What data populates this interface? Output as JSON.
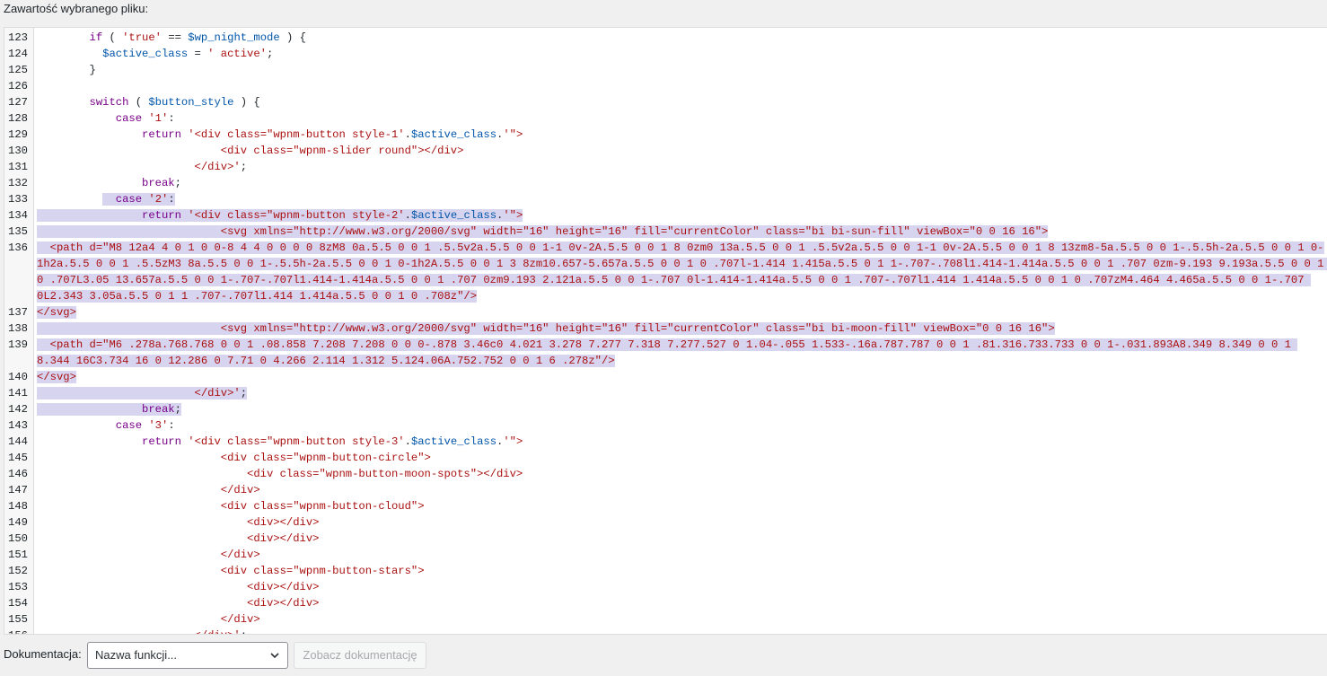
{
  "header": {
    "title": "Zawartość wybranego pliku:"
  },
  "editor": {
    "lines": [
      {
        "n": "123",
        "sel": false,
        "segs": [
          [
            "plain",
            "        "
          ],
          [
            "kw",
            "if"
          ],
          [
            "plain",
            " ( "
          ],
          [
            "str",
            "'true'"
          ],
          [
            "plain",
            " == "
          ],
          [
            "var",
            "$wp_night_mode"
          ],
          [
            "plain",
            " ) {"
          ]
        ]
      },
      {
        "n": "124",
        "sel": false,
        "segs": [
          [
            "plain",
            "          "
          ],
          [
            "var",
            "$active_class"
          ],
          [
            "plain",
            " = "
          ],
          [
            "str",
            "' active'"
          ],
          [
            "plain",
            ";"
          ]
        ]
      },
      {
        "n": "125",
        "sel": false,
        "segs": [
          [
            "plain",
            "        }"
          ]
        ]
      },
      {
        "n": "126",
        "sel": false,
        "segs": [
          [
            "plain",
            " "
          ]
        ]
      },
      {
        "n": "127",
        "sel": false,
        "segs": [
          [
            "plain",
            "        "
          ],
          [
            "kw",
            "switch"
          ],
          [
            "plain",
            " ( "
          ],
          [
            "var",
            "$button_style"
          ],
          [
            "plain",
            " ) {"
          ]
        ]
      },
      {
        "n": "128",
        "sel": false,
        "segs": [
          [
            "plain",
            "            "
          ],
          [
            "kw",
            "case"
          ],
          [
            "plain",
            " "
          ],
          [
            "str",
            "'1'"
          ],
          [
            "plain",
            ":"
          ]
        ]
      },
      {
        "n": "129",
        "sel": false,
        "segs": [
          [
            "plain",
            "                "
          ],
          [
            "kw",
            "return"
          ],
          [
            "plain",
            " "
          ],
          [
            "str",
            "'<div class=\"wpnm-button style-1'"
          ],
          [
            "plain",
            "."
          ],
          [
            "var",
            "$active_class"
          ],
          [
            "plain",
            "."
          ],
          [
            "str",
            "'\">"
          ]
        ]
      },
      {
        "n": "130",
        "sel": false,
        "segs": [
          [
            "str",
            "                            <div class=\"wpnm-slider round\"></div>"
          ]
        ]
      },
      {
        "n": "131",
        "sel": false,
        "segs": [
          [
            "str",
            "                        </div>'"
          ],
          [
            "plain",
            ";"
          ]
        ]
      },
      {
        "n": "132",
        "sel": false,
        "segs": [
          [
            "plain",
            "                "
          ],
          [
            "kw",
            "break"
          ],
          [
            "plain",
            ";"
          ]
        ]
      },
      {
        "n": "133",
        "sel": "partial",
        "pre": "          ",
        "segs": [
          [
            "plain",
            "  "
          ],
          [
            "kw",
            "case"
          ],
          [
            "plain",
            " "
          ],
          [
            "str",
            "'2'"
          ],
          [
            "plain",
            ":"
          ]
        ]
      },
      {
        "n": "134",
        "sel": true,
        "segs": [
          [
            "plain",
            "                "
          ],
          [
            "kw",
            "return"
          ],
          [
            "plain",
            " "
          ],
          [
            "str",
            "'<div class=\"wpnm-button style-2'"
          ],
          [
            "plain",
            "."
          ],
          [
            "var",
            "$active_class"
          ],
          [
            "plain",
            "."
          ],
          [
            "str",
            "'\">"
          ]
        ]
      },
      {
        "n": "135",
        "sel": true,
        "segs": [
          [
            "str",
            "                            <svg xmlns=\"http://www.w3.org/2000/svg\" width=\"16\" height=\"16\" fill=\"currentColor\" class=\"bi bi-sun-fill\" viewBox=\"0 0 16 16\">"
          ]
        ]
      },
      {
        "n": "136",
        "sel": true,
        "segs": [
          [
            "str",
            "  <path d=\"M8 12a4 4 0 1 0 0-8 4 4 0 0 0 0 8zM8 0a.5.5 0 0 1 .5.5v2a.5.5 0 0 1-1 0v-2A.5.5 0 0 1 8 0zm0 13a.5.5 0 0 1 .5.5v2a.5.5 0 0 1-1 0v-2A.5.5 0 0 1 8 13zm8-5a.5.5 0 0 1-.5.5h-2a.5.5 0 0 1 0-1h2a.5.5 0 0 1 .5.5zM3 8a.5.5 0 0 1-.5.5h-2a.5.5 0 0 1 0-1h2A.5.5 0 0 1 3 8zm10.657-5.657a.5.5 0 0 1 0 .707l-1.414 1.415a.5.5 0 1 1-.707-.708l1.414-1.414a.5.5 0 0 1 .707 0zm-9.193 9.193a.5.5 0 0 1 0 .707L3.05 13.657a.5.5 0 0 1-.707-.707l1.414-1.414a.5.5 0 0 1 .707 0zm9.193 2.121a.5.5 0 0 1-.707 0l-1.414-1.414a.5.5 0 0 1 .707-.707l1.414 1.414a.5.5 0 0 1 0 .707zM4.464 4.465a.5.5 0 0 1-.707 0L2.343 3.05a.5.5 0 1 1 .707-.707l1.414 1.414a.5.5 0 0 1 0 .708z\"/>"
          ]
        ]
      },
      {
        "n": "137",
        "sel": true,
        "segs": [
          [
            "str",
            "</svg>"
          ]
        ]
      },
      {
        "n": "138",
        "sel": true,
        "segs": [
          [
            "str",
            "                            <svg xmlns=\"http://www.w3.org/2000/svg\" width=\"16\" height=\"16\" fill=\"currentColor\" class=\"bi bi-moon-fill\" viewBox=\"0 0 16 16\">"
          ]
        ]
      },
      {
        "n": "139",
        "sel": true,
        "segs": [
          [
            "str",
            "  <path d=\"M6 .278a.768.768 0 0 1 .08.858 7.208 7.208 0 0 0-.878 3.46c0 4.021 3.278 7.277 7.318 7.277.527 0 1.04-.055 1.533-.16a.787.787 0 0 1 .81.316.733.733 0 0 1-.031.893A8.349 8.349 0 0 1 8.344 16C3.734 16 0 12.286 0 7.71 0 4.266 2.114 1.312 5.124.06A.752.752 0 0 1 6 .278z\"/>"
          ]
        ]
      },
      {
        "n": "140",
        "sel": true,
        "segs": [
          [
            "str",
            "</svg>"
          ]
        ]
      },
      {
        "n": "141",
        "sel": true,
        "segs": [
          [
            "str",
            "                        </div>'"
          ],
          [
            "plain",
            ";"
          ]
        ]
      },
      {
        "n": "142",
        "sel": true,
        "segs": [
          [
            "plain",
            "                "
          ],
          [
            "kw",
            "break"
          ],
          [
            "plain",
            ";"
          ]
        ]
      },
      {
        "n": "143",
        "sel": false,
        "segs": [
          [
            "plain",
            "            "
          ],
          [
            "kw",
            "case"
          ],
          [
            "plain",
            " "
          ],
          [
            "str",
            "'3'"
          ],
          [
            "plain",
            ":"
          ]
        ]
      },
      {
        "n": "144",
        "sel": false,
        "segs": [
          [
            "plain",
            "                "
          ],
          [
            "kw",
            "return"
          ],
          [
            "plain",
            " "
          ],
          [
            "str",
            "'<div class=\"wpnm-button style-3'"
          ],
          [
            "plain",
            "."
          ],
          [
            "var",
            "$active_class"
          ],
          [
            "plain",
            "."
          ],
          [
            "str",
            "'\">"
          ]
        ]
      },
      {
        "n": "145",
        "sel": false,
        "segs": [
          [
            "str",
            "                            <div class=\"wpnm-button-circle\">"
          ]
        ]
      },
      {
        "n": "146",
        "sel": false,
        "segs": [
          [
            "str",
            "                                <div class=\"wpnm-button-moon-spots\"></div>"
          ]
        ]
      },
      {
        "n": "147",
        "sel": false,
        "segs": [
          [
            "str",
            "                            </div>"
          ]
        ]
      },
      {
        "n": "148",
        "sel": false,
        "segs": [
          [
            "str",
            "                            <div class=\"wpnm-button-cloud\">"
          ]
        ]
      },
      {
        "n": "149",
        "sel": false,
        "segs": [
          [
            "str",
            "                                <div></div>"
          ]
        ]
      },
      {
        "n": "150",
        "sel": false,
        "segs": [
          [
            "str",
            "                                <div></div>"
          ]
        ]
      },
      {
        "n": "151",
        "sel": false,
        "segs": [
          [
            "str",
            "                            </div>"
          ]
        ]
      },
      {
        "n": "152",
        "sel": false,
        "segs": [
          [
            "str",
            "                            <div class=\"wpnm-button-stars\">"
          ]
        ]
      },
      {
        "n": "153",
        "sel": false,
        "segs": [
          [
            "str",
            "                                <div></div>"
          ]
        ]
      },
      {
        "n": "154",
        "sel": false,
        "segs": [
          [
            "str",
            "                                <div></div>"
          ]
        ]
      },
      {
        "n": "155",
        "sel": false,
        "segs": [
          [
            "str",
            "                            </div>"
          ]
        ]
      },
      {
        "n": "156",
        "sel": false,
        "segs": [
          [
            "str",
            "                        </div>'"
          ],
          [
            "plain",
            ";"
          ]
        ]
      }
    ]
  },
  "documentation": {
    "label": "Dokumentacja:",
    "select_value": "Nazwa funkcji...",
    "button_label": "Zobacz dokumentację"
  },
  "colors": {
    "selection": "#d7d4f0",
    "keyword": "#770088",
    "variable": "#0055aa",
    "string": "#aa1111"
  },
  "icons": {
    "select_arrow": "chevron-down-icon"
  }
}
